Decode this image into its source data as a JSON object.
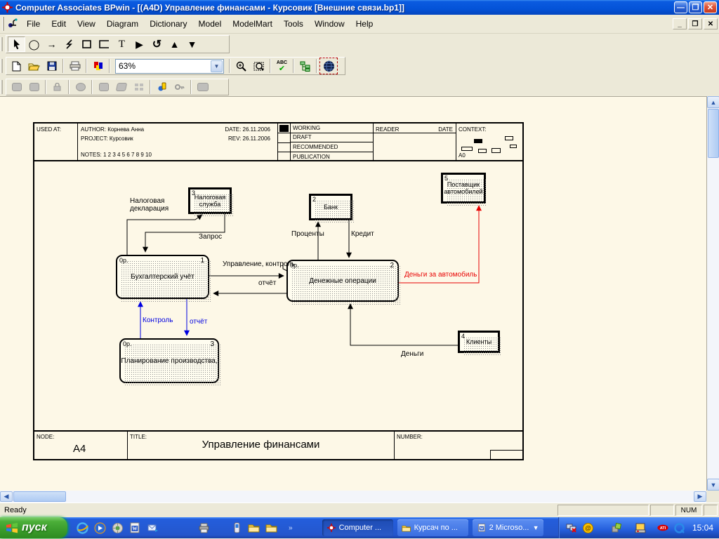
{
  "window": {
    "title": "Computer Associates BPwin - [(A4D) Управление финансами - Курсовик  [Внешние связи.bp1]]"
  },
  "menu": {
    "items": [
      "File",
      "Edit",
      "View",
      "Diagram",
      "Dictionary",
      "Model",
      "ModelMart",
      "Tools",
      "Window",
      "Help"
    ]
  },
  "toolbar": {
    "zoom_value": "63%",
    "spell_label": "ABC"
  },
  "sheet": {
    "header": {
      "used_at": "USED AT:",
      "author": "AUTHOR:  Корнева Анна",
      "date": "DATE:  26.11.2006",
      "project": "PROJECT:  Курсовик",
      "rev": "REV:   26.11.2006",
      "notes": "NOTES:  1  2  3  4  5  6  7  8  9  10",
      "statuses": [
        "WORKING",
        "DRAFT",
        "RECOMMENDED",
        "PUBLICATION"
      ],
      "reader": "READER",
      "date_col": "DATE",
      "context": "CONTEXT:",
      "context_node": "A0"
    },
    "footer": {
      "node_label": "NODE:",
      "node": "A4",
      "title_label": "TITLE:",
      "title": "Управление финансами",
      "number_label": "NUMBER:"
    }
  },
  "diagram": {
    "boxes": [
      {
        "number": "3",
        "label": "Налоговая служба",
        "type": "external"
      },
      {
        "number": "2",
        "label": "Банк",
        "type": "external"
      },
      {
        "number": "5",
        "label": "Поставщик автомобилей",
        "type": "external"
      },
      {
        "number": "4",
        "label": "Клиенты",
        "type": "external"
      },
      {
        "cost": "0р.",
        "number": "1",
        "label": "Бухгалтерский учёт",
        "type": "activity"
      },
      {
        "cost": "0р.",
        "number": "2",
        "label": "Денежные операции",
        "type": "activity"
      },
      {
        "cost": "0р.",
        "number": "3",
        "label": "Планирование производства,",
        "type": "activity"
      }
    ],
    "arrows": [
      {
        "label": "Налоговая декларация",
        "color": "#000000"
      },
      {
        "label": "Запрос",
        "color": "#000000"
      },
      {
        "label": "Управление, контроль",
        "color": "#000000"
      },
      {
        "label": "отчёт",
        "color": "#000000"
      },
      {
        "label": "Проценты",
        "color": "#000000"
      },
      {
        "label": "Кредит",
        "color": "#000000"
      },
      {
        "label": "Деньги за автомобиль",
        "color": "#e80000"
      },
      {
        "label": "Деньги",
        "color": "#000000"
      },
      {
        "label": "Контроль",
        "color": "#0000e0"
      },
      {
        "label": "отчёт",
        "color": "#0000e0"
      }
    ]
  },
  "statusbar": {
    "ready": "Ready",
    "num": "NUM"
  },
  "taskbar": {
    "start": "пуск",
    "buttons": [
      "Computer ...",
      "Курсач по ...",
      "2 Microso..."
    ],
    "clock": "15:04"
  }
}
